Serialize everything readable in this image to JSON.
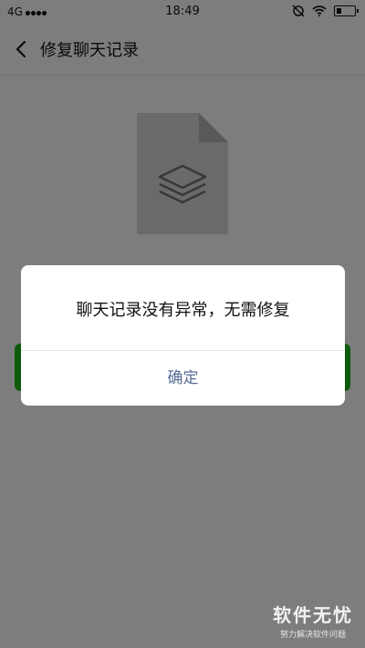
{
  "status_bar": {
    "network": "4G",
    "time": "18:49"
  },
  "navbar": {
    "title": "修复聊天记录"
  },
  "dialog": {
    "message": "聊天记录没有异常，无需修复",
    "confirm_label": "确定"
  },
  "watermark": {
    "main": "软件无忧",
    "sub": "努力解决软件问题"
  },
  "colors": {
    "dialog_button": "#576b95",
    "primary_green": "#1aad19",
    "background": "#ededed"
  }
}
